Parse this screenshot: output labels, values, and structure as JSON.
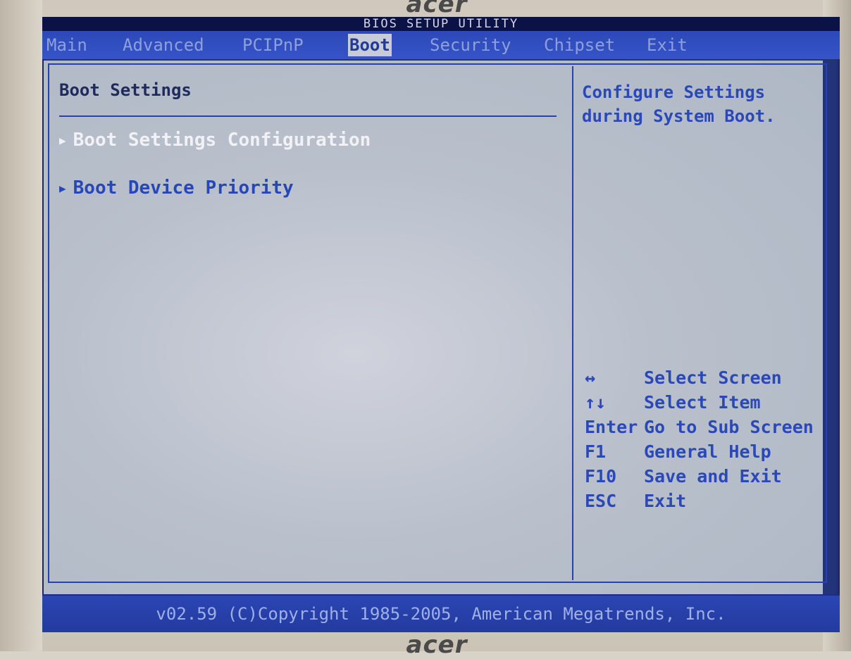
{
  "brand": "acer",
  "title": "BIOS SETUP UTILITY",
  "tabs": [
    {
      "label": "Main"
    },
    {
      "label": "Advanced"
    },
    {
      "label": "PCIPnP"
    },
    {
      "label": "Boot"
    },
    {
      "label": "Security"
    },
    {
      "label": "Chipset"
    },
    {
      "label": "Exit"
    }
  ],
  "active_tab": "Boot",
  "section_title": "Boot Settings",
  "items": [
    {
      "label": "Boot Settings Configuration",
      "selected": true
    },
    {
      "label": "Boot Device Priority",
      "selected": false
    }
  ],
  "help_text": "Configure Settings during System Boot.",
  "keys": [
    {
      "key": "↔",
      "action": "Select Screen"
    },
    {
      "key": "↑↓",
      "action": "Select Item"
    },
    {
      "key": "Enter",
      "action": "Go to Sub Screen"
    },
    {
      "key": "F1",
      "action": "General Help"
    },
    {
      "key": "F10",
      "action": "Save and Exit"
    },
    {
      "key": "ESC",
      "action": "Exit"
    }
  ],
  "footer": "v02.59 (C)Copyright 1985-2005, American Megatrends, Inc.",
  "icons": {
    "submenu": "triangle-right-icon"
  },
  "colors": {
    "accent": "#2a48b8",
    "menubar": "#3654c8",
    "panel": "#b9c0cc"
  }
}
